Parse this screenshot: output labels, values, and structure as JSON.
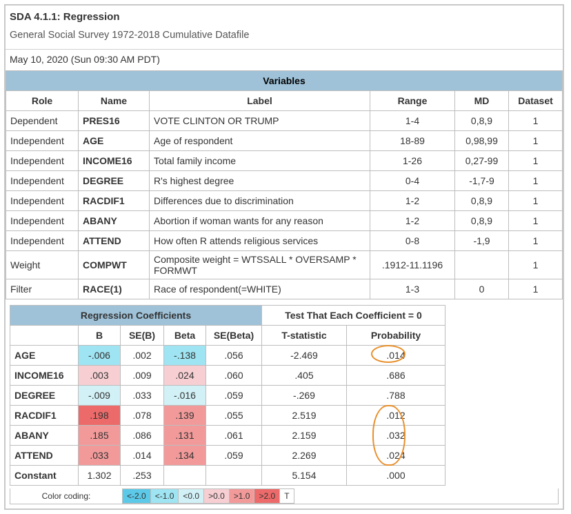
{
  "header": {
    "title": "SDA 4.1.1: Regression",
    "subtitle": "General Social Survey 1972-2018 Cumulative Datafile",
    "timestamp": "May 10, 2020 (Sun 09:30 AM PDT)"
  },
  "variables": {
    "header": "Variables",
    "cols": {
      "role": "Role",
      "name": "Name",
      "label": "Label",
      "range": "Range",
      "md": "MD",
      "dataset": "Dataset"
    },
    "rows": [
      {
        "role": "Dependent",
        "name": "PRES16",
        "label": "VOTE CLINTON OR TRUMP",
        "range": "1-4",
        "md": "0,8,9",
        "dataset": "1"
      },
      {
        "role": "Independent",
        "name": "AGE",
        "label": "Age of respondent",
        "range": "18-89",
        "md": "0,98,99",
        "dataset": "1"
      },
      {
        "role": "Independent",
        "name": "INCOME16",
        "label": "Total family income",
        "range": "1-26",
        "md": "0,27-99",
        "dataset": "1"
      },
      {
        "role": "Independent",
        "name": "DEGREE",
        "label": "R's highest degree",
        "range": "0-4",
        "md": "-1,7-9",
        "dataset": "1"
      },
      {
        "role": "Independent",
        "name": "RACDIF1",
        "label": "Differences due to discrimination",
        "range": "1-2",
        "md": "0,8,9",
        "dataset": "1"
      },
      {
        "role": "Independent",
        "name": "ABANY",
        "label": "Abortion if woman wants for any reason",
        "range": "1-2",
        "md": "0,8,9",
        "dataset": "1"
      },
      {
        "role": "Independent",
        "name": "ATTEND",
        "label": "How often R attends religious services",
        "range": "0-8",
        "md": "-1,9",
        "dataset": "1"
      },
      {
        "role": "Weight",
        "name": "COMPWT",
        "label": "Composite weight = WTSSALL * OVERSAMP * FORMWT",
        "range": ".1912-11.1196",
        "md": "",
        "dataset": "1"
      },
      {
        "role": "Filter",
        "name": "RACE(1)",
        "label": "Race of respondent(=WHITE)",
        "range": "1-3",
        "md": "0",
        "dataset": "1"
      }
    ]
  },
  "coef": {
    "header_left": "Regression Coefficients",
    "header_right": "Test That Each Coefficient = 0",
    "cols": {
      "b": "B",
      "seb": "SE(B)",
      "beta": "Beta",
      "sebeta": "SE(Beta)",
      "t": "T-statistic",
      "p": "Probability"
    },
    "rows": [
      {
        "name": "AGE",
        "b": "-.006",
        "seb": ".002",
        "beta": "-.138",
        "sebeta": ".056",
        "t": "-2.469",
        "p": ".014",
        "b_class": "c-ltblue",
        "beta_class": "c-ltblue"
      },
      {
        "name": "INCOME16",
        "b": ".003",
        "seb": ".009",
        "beta": ".024",
        "sebeta": ".060",
        "t": ".405",
        "p": ".686",
        "b_class": "c-pink",
        "beta_class": "c-pink"
      },
      {
        "name": "DEGREE",
        "b": "-.009",
        "seb": ".033",
        "beta": "-.016",
        "sebeta": ".059",
        "t": "-.269",
        "p": ".788",
        "b_class": "c-paleblue",
        "beta_class": "c-paleblue"
      },
      {
        "name": "RACDIF1",
        "b": ".198",
        "seb": ".078",
        "beta": ".139",
        "sebeta": ".055",
        "t": "2.519",
        "p": ".012",
        "b_class": "c-red",
        "beta_class": "c-salmon"
      },
      {
        "name": "ABANY",
        "b": ".185",
        "seb": ".086",
        "beta": ".131",
        "sebeta": ".061",
        "t": "2.159",
        "p": ".032",
        "b_class": "c-salmon",
        "beta_class": "c-salmon"
      },
      {
        "name": "ATTEND",
        "b": ".033",
        "seb": ".014",
        "beta": ".134",
        "sebeta": ".059",
        "t": "2.269",
        "p": ".024",
        "b_class": "c-salmon",
        "beta_class": "c-salmon"
      },
      {
        "name": "Constant",
        "b": "1.302",
        "seb": ".253",
        "beta": "",
        "sebeta": "",
        "t": "5.154",
        "p": ".000",
        "b_class": "",
        "beta_class": ""
      }
    ]
  },
  "legend": {
    "label": "Color coding:",
    "items": [
      {
        "text": "<-2.0",
        "class": "c-blue2"
      },
      {
        "text": "<-1.0",
        "class": "c-ltblue"
      },
      {
        "text": "<0.0",
        "class": "c-paleblue"
      },
      {
        "text": ">0.0",
        "class": "c-pink"
      },
      {
        "text": ">1.0",
        "class": "c-salmon"
      },
      {
        "text": ">2.0",
        "class": "c-red"
      },
      {
        "text": "T",
        "class": ""
      }
    ]
  }
}
